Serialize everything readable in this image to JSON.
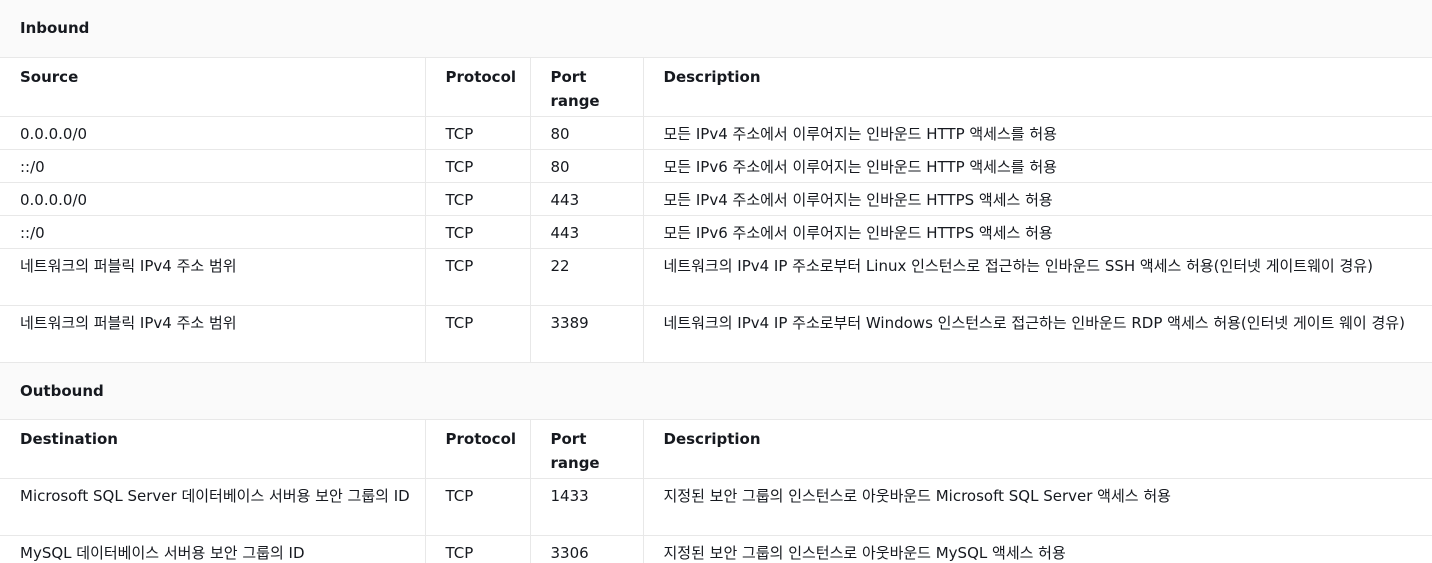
{
  "inbound": {
    "title": "Inbound",
    "headers": {
      "source": "Source",
      "protocol": "Protocol",
      "port": "Port range",
      "description": "Description"
    },
    "rows": [
      {
        "source": "0.0.0.0/0",
        "protocol": "TCP",
        "port": "80",
        "description": "모든 IPv4 주소에서 이루어지는 인바운드 HTTP 액세스를 허용"
      },
      {
        "source": "::/0",
        "protocol": "TCP",
        "port": "80",
        "description": "모든 IPv6 주소에서 이루어지는 인바운드 HTTP 액세스를 허용"
      },
      {
        "source": "0.0.0.0/0",
        "protocol": "TCP",
        "port": "443",
        "description": "모든 IPv4 주소에서 이루어지는 인바운드 HTTPS 액세스 허용"
      },
      {
        "source": "::/0",
        "protocol": "TCP",
        "port": "443",
        "description": "모든 IPv6 주소에서 이루어지는 인바운드 HTTPS 액세스 허용"
      },
      {
        "source": "네트워크의 퍼블릭 IPv4 주소 범위",
        "protocol": "TCP",
        "port": "22",
        "description": "네트워크의 IPv4 IP 주소로부터 Linux 인스턴스로 접근하는 인바운드 SSH 액세스 허용(인터넷 게이트웨이 경유)"
      },
      {
        "source": "네트워크의 퍼블릭 IPv4 주소 범위",
        "protocol": "TCP",
        "port": "3389",
        "description": "네트워크의 IPv4 IP 주소로부터 Windows 인스턴스로 접근하는 인바운드 RDP 액세스 허용(인터넷 게이트 웨이 경유)"
      }
    ]
  },
  "outbound": {
    "title": "Outbound",
    "headers": {
      "destination": "Destination",
      "protocol": "Protocol",
      "port": "Port range",
      "description": "Description"
    },
    "rows": [
      {
        "destination": "Microsoft SQL Server 데이터베이스 서버용 보안 그룹의 ID",
        "protocol": "TCP",
        "port": "1433",
        "description": "지정된 보안 그룹의 인스턴스로 아웃바운드 Microsoft SQL Server 액세스 허용"
      },
      {
        "destination": "MySQL 데이터베이스 서버용 보안 그룹의 ID",
        "protocol": "TCP",
        "port": "3306",
        "description": "지정된 보안 그룹의 인스턴스로 아웃바운드 MySQL 액세스 허용"
      }
    ]
  }
}
